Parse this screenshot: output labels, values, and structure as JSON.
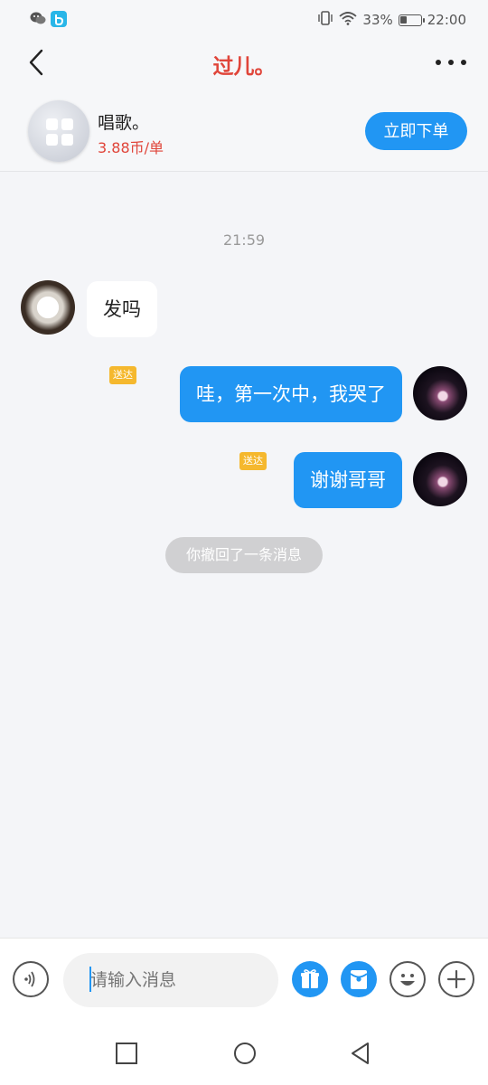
{
  "status_bar": {
    "battery_percent": "33%",
    "battery_level": 0.33,
    "time": "22:00",
    "icons": [
      "wechat-icon",
      "app-icon",
      "vibrate-icon",
      "wifi-icon",
      "battery-icon"
    ]
  },
  "header": {
    "title": "过儿。",
    "back_icon": "chevron-left-icon",
    "more_icon": "more-dots-icon"
  },
  "service": {
    "name": "唱歌。",
    "price": "3.88币/单",
    "order_button": "立即下单"
  },
  "chat": {
    "timestamp": "21:59",
    "messages": [
      {
        "side": "incoming",
        "text": "发吗"
      },
      {
        "side": "outgoing",
        "text": "哇，第一次中，我哭了",
        "status": "送达"
      },
      {
        "side": "outgoing",
        "text": "谢谢哥哥",
        "status": "送达"
      }
    ],
    "recall_notice": "你撤回了一条消息"
  },
  "input_bar": {
    "placeholder": "请输入消息",
    "icons": [
      "voice-icon",
      "gift-icon",
      "red-packet-icon",
      "emoji-icon",
      "plus-icon"
    ]
  },
  "colors": {
    "accent": "#2196f3",
    "title_red": "#e0453a",
    "delivered_tag": "#f5b82e"
  }
}
